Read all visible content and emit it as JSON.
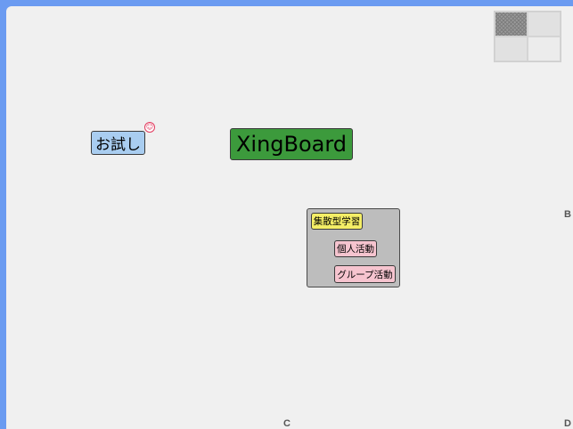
{
  "board": {
    "cards": {
      "trial": "お試し",
      "xingboard": "XingBoard",
      "group_title": "集散型学習",
      "individual": "個人活動",
      "group_activity": "グループ活動"
    },
    "badge_icon": "face-icon",
    "edge_labels": {
      "b": "B",
      "c": "C",
      "d": "D"
    }
  },
  "minimap": {
    "active_cell": "top-left"
  },
  "colors": {
    "background": "#6b9bf1",
    "board": "#f0f0f0",
    "card_blue": "#a9cdf0",
    "card_green": "#3c9a3c",
    "card_yellow": "#f4ee66",
    "card_pink": "#f6c4cf",
    "group_gray": "#bdbdbd"
  }
}
